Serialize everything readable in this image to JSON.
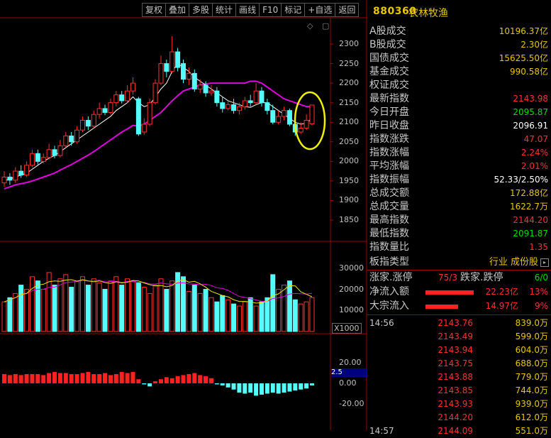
{
  "toolbar": {
    "items": [
      "复权",
      "叠加",
      "多股",
      "统计",
      "画线",
      "F10",
      "标记",
      "+自选",
      "返回"
    ]
  },
  "mini_icons": {
    "diamond": "◇",
    "square": "▢"
  },
  "axes": {
    "price_ticks": [
      "2300",
      "2250",
      "2200",
      "2150",
      "2100",
      "2050",
      "2000",
      "1950",
      "1900",
      "1850"
    ],
    "volume_ticks": [
      "30000",
      "20000",
      "10000"
    ],
    "volume_unit": "X1000",
    "macd_ticks": [
      "20.00",
      "0.00",
      "-20.00"
    ],
    "cursor_value": "2.5"
  },
  "header": {
    "code": "880360",
    "name": "农林牧渔"
  },
  "stats": [
    {
      "label": "A股成交",
      "value": "10196.37亿",
      "color": "#e6c600"
    },
    {
      "label": "B股成交",
      "value": "2.30亿",
      "color": "#e6c600"
    },
    {
      "label": "国债成交",
      "value": "15625.50亿",
      "color": "#e6c600"
    },
    {
      "label": "基金成交",
      "value": "990.58亿",
      "color": "#e6c600"
    },
    {
      "label": "权证成交",
      "value": "",
      "color": "#e6c600"
    },
    {
      "label": "最新指数",
      "value": "2143.98",
      "color": "#ff3030"
    },
    {
      "label": "今日开盘",
      "value": "2095.87",
      "color": "#00dd00"
    },
    {
      "label": "昨日收盘",
      "value": "2096.91",
      "color": "#ffffff"
    },
    {
      "label": "指数涨跌",
      "value": "47.07",
      "color": "#ff3030"
    },
    {
      "label": "指数涨幅",
      "value": "2.24%",
      "color": "#ff3030"
    },
    {
      "label": "平均涨幅",
      "value": "2.01%",
      "color": "#ff3030"
    },
    {
      "label": "指数振幅",
      "value": "52.33/2.50%",
      "color": "#ffffff"
    },
    {
      "label": "总成交额",
      "value": "172.88亿",
      "color": "#e6c600"
    },
    {
      "label": "总成交量",
      "value": "1622.7万",
      "color": "#e6c600"
    },
    {
      "label": "最高指数",
      "value": "2144.20",
      "color": "#ff3030"
    },
    {
      "label": "最低指数",
      "value": "2091.87",
      "color": "#00dd00"
    },
    {
      "label": "指数量比",
      "value": "1.35",
      "color": "#ff3030"
    }
  ],
  "board": {
    "label": "板指类型",
    "value": "行业 成份股"
  },
  "updown": {
    "up_label": "涨家.涨停",
    "up_value": "75/3",
    "down_label": "跌家.跌停",
    "down_value": "6/0"
  },
  "flows": [
    {
      "label": "净流入额",
      "value": "22.23亿",
      "pct": "13%"
    },
    {
      "label": "大宗流入",
      "value": "14.97亿",
      "pct": "9%"
    }
  ],
  "ticks": [
    {
      "time": "14:56",
      "price": "2143.76",
      "vol": "839.0万"
    },
    {
      "time": "",
      "price": "2143.49",
      "vol": "599.0万"
    },
    {
      "time": "",
      "price": "2143.94",
      "vol": "604.0万"
    },
    {
      "time": "",
      "price": "2143.75",
      "vol": "688.0万"
    },
    {
      "time": "",
      "price": "2143.88",
      "vol": "779.0万"
    },
    {
      "time": "",
      "price": "2143.85",
      "vol": "744.0万"
    },
    {
      "time": "",
      "price": "2143.93",
      "vol": "939.0万"
    },
    {
      "time": "",
      "price": "2144.20",
      "vol": "612.0万"
    },
    {
      "time": "14:57",
      "price": "2144.09",
      "vol": "551.0万"
    }
  ],
  "chart_data": {
    "type": "candlestick",
    "candles": [
      {
        "o": 1945,
        "c": 1960,
        "h": 1975,
        "l": 1935
      },
      {
        "o": 1960,
        "c": 1952,
        "h": 1970,
        "l": 1940
      },
      {
        "o": 1952,
        "c": 1975,
        "h": 1985,
        "l": 1945
      },
      {
        "o": 1975,
        "c": 1965,
        "h": 1990,
        "l": 1958
      },
      {
        "o": 1965,
        "c": 1990,
        "h": 2000,
        "l": 1960
      },
      {
        "o": 1990,
        "c": 2020,
        "h": 2030,
        "l": 1985
      },
      {
        "o": 2020,
        "c": 2000,
        "h": 2030,
        "l": 1992
      },
      {
        "o": 2000,
        "c": 2010,
        "h": 2020,
        "l": 1995
      },
      {
        "o": 2010,
        "c": 2030,
        "h": 2045,
        "l": 2005
      },
      {
        "o": 2030,
        "c": 2015,
        "h": 2040,
        "l": 2008
      },
      {
        "o": 2015,
        "c": 2040,
        "h": 2055,
        "l": 2010
      },
      {
        "o": 2040,
        "c": 2065,
        "h": 2075,
        "l": 2035
      },
      {
        "o": 2065,
        "c": 2050,
        "h": 2075,
        "l": 2040
      },
      {
        "o": 2050,
        "c": 2080,
        "h": 2090,
        "l": 2045
      },
      {
        "o": 2080,
        "c": 2105,
        "h": 2115,
        "l": 2075
      },
      {
        "o": 2105,
        "c": 2090,
        "h": 2115,
        "l": 2080
      },
      {
        "o": 2090,
        "c": 2120,
        "h": 2130,
        "l": 2085
      },
      {
        "o": 2120,
        "c": 2135,
        "h": 2150,
        "l": 2110
      },
      {
        "o": 2135,
        "c": 2125,
        "h": 2145,
        "l": 2118
      },
      {
        "o": 2125,
        "c": 2150,
        "h": 2160,
        "l": 2120
      },
      {
        "o": 2150,
        "c": 2170,
        "h": 2180,
        "l": 2140
      },
      {
        "o": 2170,
        "c": 2155,
        "h": 2180,
        "l": 2148
      },
      {
        "o": 2155,
        "c": 2180,
        "h": 2195,
        "l": 2150
      },
      {
        "o": 2180,
        "c": 2200,
        "h": 2215,
        "l": 2170
      },
      {
        "o": 2160,
        "c": 2070,
        "h": 2165,
        "l": 2065
      },
      {
        "o": 2075,
        "c": 2095,
        "h": 2110,
        "l": 2068
      },
      {
        "o": 2095,
        "c": 2150,
        "h": 2160,
        "l": 2090
      },
      {
        "o": 2150,
        "c": 2200,
        "h": 2210,
        "l": 2145
      },
      {
        "o": 2200,
        "c": 2250,
        "h": 2270,
        "l": 2195
      },
      {
        "o": 2250,
        "c": 2230,
        "h": 2260,
        "l": 2215
      },
      {
        "o": 2230,
        "c": 2280,
        "h": 2320,
        "l": 2225
      },
      {
        "o": 2280,
        "c": 2240,
        "h": 2290,
        "l": 2230
      },
      {
        "o": 2250,
        "c": 2210,
        "h": 2260,
        "l": 2200
      },
      {
        "o": 2210,
        "c": 2225,
        "h": 2240,
        "l": 2195
      },
      {
        "o": 2225,
        "c": 2185,
        "h": 2235,
        "l": 2178
      },
      {
        "o": 2185,
        "c": 2195,
        "h": 2210,
        "l": 2175
      },
      {
        "o": 2195,
        "c": 2175,
        "h": 2205,
        "l": 2165
      },
      {
        "o": 2175,
        "c": 2180,
        "h": 2195,
        "l": 2168
      },
      {
        "o": 2180,
        "c": 2150,
        "h": 2190,
        "l": 2140
      },
      {
        "o": 2150,
        "c": 2135,
        "h": 2165,
        "l": 2125
      },
      {
        "o": 2135,
        "c": 2145,
        "h": 2155,
        "l": 2130
      },
      {
        "o": 2145,
        "c": 2130,
        "h": 2160,
        "l": 2122
      },
      {
        "o": 2130,
        "c": 2140,
        "h": 2150,
        "l": 2120
      },
      {
        "o": 2140,
        "c": 2155,
        "h": 2165,
        "l": 2132
      },
      {
        "o": 2155,
        "c": 2150,
        "h": 2170,
        "l": 2140
      },
      {
        "o": 2150,
        "c": 2180,
        "h": 2200,
        "l": 2145
      },
      {
        "o": 2180,
        "c": 2150,
        "h": 2190,
        "l": 2140
      },
      {
        "o": 2150,
        "c": 2130,
        "h": 2160,
        "l": 2120
      },
      {
        "o": 2130,
        "c": 2100,
        "h": 2145,
        "l": 2095
      },
      {
        "o": 2100,
        "c": 2115,
        "h": 2130,
        "l": 2095
      },
      {
        "o": 2115,
        "c": 2130,
        "h": 2140,
        "l": 2105
      },
      {
        "o": 2130,
        "c": 2095,
        "h": 2135,
        "l": 2090
      },
      {
        "o": 2095,
        "c": 2075,
        "h": 2105,
        "l": 2065
      },
      {
        "o": 2075,
        "c": 2085,
        "h": 2100,
        "l": 2070
      },
      {
        "o": 2085,
        "c": 2105,
        "h": 2120,
        "l": 2080
      },
      {
        "o": 2096,
        "c": 2144,
        "h": 2144,
        "l": 2092
      }
    ],
    "ma5": [
      1950,
      1955,
      1960,
      1965,
      1970,
      1980,
      1990,
      2000,
      2008,
      2015,
      2025,
      2035,
      2045,
      2055,
      2065,
      2075,
      2085,
      2095,
      2105,
      2115,
      2130,
      2140,
      2150,
      2165,
      2150,
      2140,
      2145,
      2165,
      2185,
      2200,
      2230,
      2250,
      2240,
      2230,
      2215,
      2205,
      2195,
      2185,
      2175,
      2165,
      2155,
      2150,
      2145,
      2140,
      2138,
      2145,
      2150,
      2150,
      2140,
      2130,
      2120,
      2110,
      2100,
      2095,
      2098,
      2110
    ],
    "ma10": [
      1930,
      1935,
      1940,
      1943,
      1946,
      1950,
      1955,
      1960,
      1965,
      1970,
      1978,
      1985,
      1992,
      2000,
      2008,
      2016,
      2025,
      2035,
      2045,
      2055,
      2065,
      2075,
      2083,
      2092,
      2090,
      2095,
      2105,
      2115,
      2125,
      2140,
      2155,
      2168,
      2180,
      2185,
      2190,
      2195,
      2198,
      2200,
      2200,
      2200,
      2200,
      2200,
      2200,
      2200,
      2205,
      2205,
      2200,
      2190,
      2180,
      2170,
      2160,
      2155,
      2150,
      2145,
      2140,
      2140
    ],
    "volume": [
      14000,
      16000,
      18000,
      22000,
      20000,
      26000,
      24000,
      20000,
      28000,
      22000,
      25000,
      27000,
      21000,
      24000,
      26000,
      22000,
      25000,
      23000,
      20000,
      24000,
      26000,
      22000,
      25000,
      24000,
      23000,
      21000,
      18000,
      22000,
      25000,
      20000,
      24000,
      28000,
      26000,
      19000,
      22000,
      18000,
      20000,
      16000,
      14000,
      17000,
      15000,
      13000,
      12000,
      14000,
      16000,
      12000,
      14000,
      16000,
      27000,
      20000,
      22000,
      24000,
      15000,
      13000,
      14000,
      16000
    ],
    "macd": [
      9,
      8,
      9,
      8,
      9,
      9,
      9,
      8,
      10,
      11,
      10,
      10,
      9,
      9,
      10,
      11,
      9,
      9,
      10,
      8,
      9,
      11,
      10,
      11,
      4,
      -1,
      -3,
      2,
      4,
      6,
      5,
      7,
      8,
      9,
      10,
      8,
      7,
      5,
      -1,
      -2,
      -4,
      -6,
      -9,
      -10,
      -9,
      -12,
      -11,
      -10,
      -9,
      -10,
      -9,
      -8,
      -7,
      -6,
      -5,
      -2
    ],
    "ylim": [
      1800,
      2330
    ]
  }
}
